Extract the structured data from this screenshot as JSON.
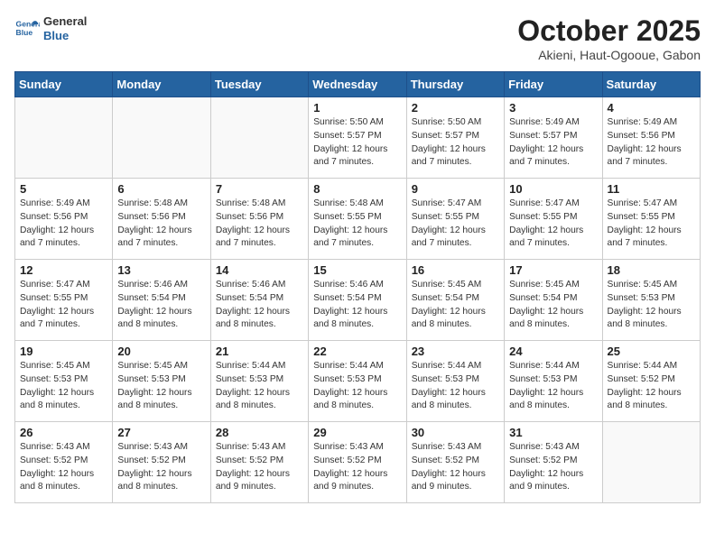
{
  "header": {
    "logo_line1": "General",
    "logo_line2": "Blue",
    "month": "October 2025",
    "location": "Akieni, Haut-Ogooue, Gabon"
  },
  "weekdays": [
    "Sunday",
    "Monday",
    "Tuesday",
    "Wednesday",
    "Thursday",
    "Friday",
    "Saturday"
  ],
  "weeks": [
    [
      {
        "day": "",
        "info": ""
      },
      {
        "day": "",
        "info": ""
      },
      {
        "day": "",
        "info": ""
      },
      {
        "day": "1",
        "info": "Sunrise: 5:50 AM\nSunset: 5:57 PM\nDaylight: 12 hours\nand 7 minutes."
      },
      {
        "day": "2",
        "info": "Sunrise: 5:50 AM\nSunset: 5:57 PM\nDaylight: 12 hours\nand 7 minutes."
      },
      {
        "day": "3",
        "info": "Sunrise: 5:49 AM\nSunset: 5:57 PM\nDaylight: 12 hours\nand 7 minutes."
      },
      {
        "day": "4",
        "info": "Sunrise: 5:49 AM\nSunset: 5:56 PM\nDaylight: 12 hours\nand 7 minutes."
      }
    ],
    [
      {
        "day": "5",
        "info": "Sunrise: 5:49 AM\nSunset: 5:56 PM\nDaylight: 12 hours\nand 7 minutes."
      },
      {
        "day": "6",
        "info": "Sunrise: 5:48 AM\nSunset: 5:56 PM\nDaylight: 12 hours\nand 7 minutes."
      },
      {
        "day": "7",
        "info": "Sunrise: 5:48 AM\nSunset: 5:56 PM\nDaylight: 12 hours\nand 7 minutes."
      },
      {
        "day": "8",
        "info": "Sunrise: 5:48 AM\nSunset: 5:55 PM\nDaylight: 12 hours\nand 7 minutes."
      },
      {
        "day": "9",
        "info": "Sunrise: 5:47 AM\nSunset: 5:55 PM\nDaylight: 12 hours\nand 7 minutes."
      },
      {
        "day": "10",
        "info": "Sunrise: 5:47 AM\nSunset: 5:55 PM\nDaylight: 12 hours\nand 7 minutes."
      },
      {
        "day": "11",
        "info": "Sunrise: 5:47 AM\nSunset: 5:55 PM\nDaylight: 12 hours\nand 7 minutes."
      }
    ],
    [
      {
        "day": "12",
        "info": "Sunrise: 5:47 AM\nSunset: 5:55 PM\nDaylight: 12 hours\nand 7 minutes."
      },
      {
        "day": "13",
        "info": "Sunrise: 5:46 AM\nSunset: 5:54 PM\nDaylight: 12 hours\nand 8 minutes."
      },
      {
        "day": "14",
        "info": "Sunrise: 5:46 AM\nSunset: 5:54 PM\nDaylight: 12 hours\nand 8 minutes."
      },
      {
        "day": "15",
        "info": "Sunrise: 5:46 AM\nSunset: 5:54 PM\nDaylight: 12 hours\nand 8 minutes."
      },
      {
        "day": "16",
        "info": "Sunrise: 5:45 AM\nSunset: 5:54 PM\nDaylight: 12 hours\nand 8 minutes."
      },
      {
        "day": "17",
        "info": "Sunrise: 5:45 AM\nSunset: 5:54 PM\nDaylight: 12 hours\nand 8 minutes."
      },
      {
        "day": "18",
        "info": "Sunrise: 5:45 AM\nSunset: 5:53 PM\nDaylight: 12 hours\nand 8 minutes."
      }
    ],
    [
      {
        "day": "19",
        "info": "Sunrise: 5:45 AM\nSunset: 5:53 PM\nDaylight: 12 hours\nand 8 minutes."
      },
      {
        "day": "20",
        "info": "Sunrise: 5:45 AM\nSunset: 5:53 PM\nDaylight: 12 hours\nand 8 minutes."
      },
      {
        "day": "21",
        "info": "Sunrise: 5:44 AM\nSunset: 5:53 PM\nDaylight: 12 hours\nand 8 minutes."
      },
      {
        "day": "22",
        "info": "Sunrise: 5:44 AM\nSunset: 5:53 PM\nDaylight: 12 hours\nand 8 minutes."
      },
      {
        "day": "23",
        "info": "Sunrise: 5:44 AM\nSunset: 5:53 PM\nDaylight: 12 hours\nand 8 minutes."
      },
      {
        "day": "24",
        "info": "Sunrise: 5:44 AM\nSunset: 5:53 PM\nDaylight: 12 hours\nand 8 minutes."
      },
      {
        "day": "25",
        "info": "Sunrise: 5:44 AM\nSunset: 5:52 PM\nDaylight: 12 hours\nand 8 minutes."
      }
    ],
    [
      {
        "day": "26",
        "info": "Sunrise: 5:43 AM\nSunset: 5:52 PM\nDaylight: 12 hours\nand 8 minutes."
      },
      {
        "day": "27",
        "info": "Sunrise: 5:43 AM\nSunset: 5:52 PM\nDaylight: 12 hours\nand 8 minutes."
      },
      {
        "day": "28",
        "info": "Sunrise: 5:43 AM\nSunset: 5:52 PM\nDaylight: 12 hours\nand 9 minutes."
      },
      {
        "day": "29",
        "info": "Sunrise: 5:43 AM\nSunset: 5:52 PM\nDaylight: 12 hours\nand 9 minutes."
      },
      {
        "day": "30",
        "info": "Sunrise: 5:43 AM\nSunset: 5:52 PM\nDaylight: 12 hours\nand 9 minutes."
      },
      {
        "day": "31",
        "info": "Sunrise: 5:43 AM\nSunset: 5:52 PM\nDaylight: 12 hours\nand 9 minutes."
      },
      {
        "day": "",
        "info": ""
      }
    ]
  ]
}
